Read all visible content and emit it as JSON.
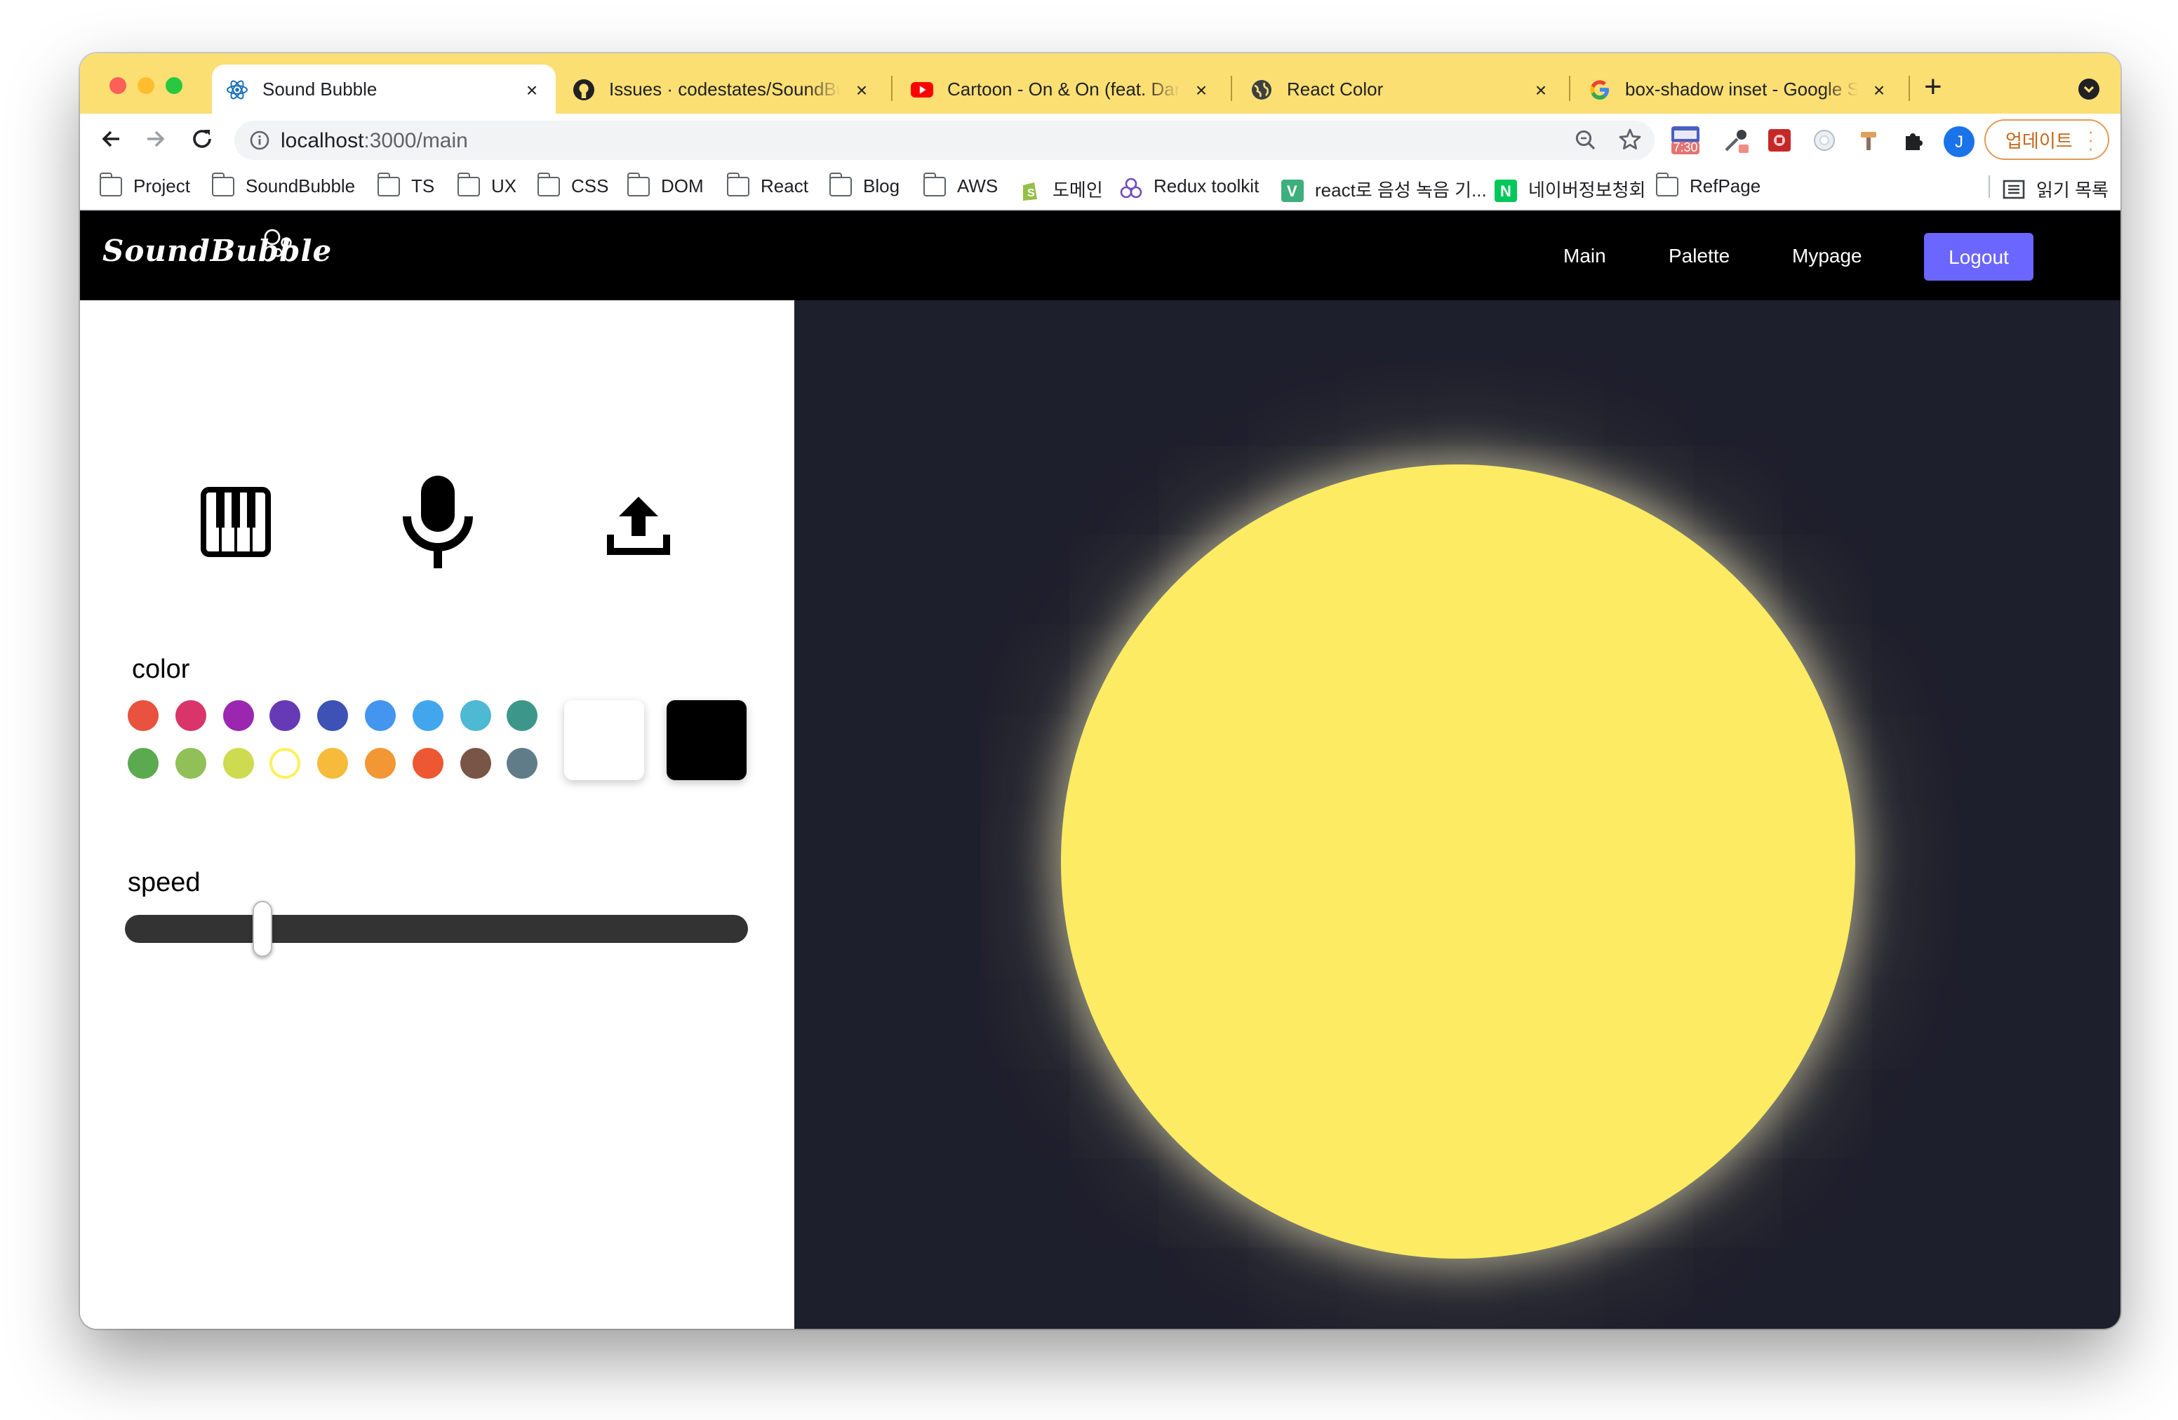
{
  "browser": {
    "tabs": [
      {
        "title": "Sound Bubble",
        "active": true,
        "favicon": "react-icon"
      },
      {
        "title": "Issues · codestates/SoundBubble",
        "active": false,
        "favicon": "github-icon"
      },
      {
        "title": "Cartoon - On & On (feat. Daniel Levi)",
        "active": false,
        "favicon": "youtube-icon"
      },
      {
        "title": "React Color",
        "active": false,
        "favicon": "globe-icon"
      },
      {
        "title": "box-shadow inset - Google Search",
        "active": false,
        "favicon": "google-icon"
      }
    ],
    "close_glyph": "×",
    "new_tab_glyph": "+",
    "url_host": "localhost",
    "url_path": ":3000/main",
    "extension_badge": "7:30",
    "avatar_letter": "J",
    "update_label": "업데이트",
    "bookmarks": [
      {
        "label": "Project",
        "icon": "folder-icon"
      },
      {
        "label": "SoundBubble",
        "icon": "folder-icon"
      },
      {
        "label": "TS",
        "icon": "folder-icon"
      },
      {
        "label": "UX",
        "icon": "folder-icon"
      },
      {
        "label": "CSS",
        "icon": "folder-icon"
      },
      {
        "label": "DOM",
        "icon": "folder-icon"
      },
      {
        "label": "React",
        "icon": "folder-icon"
      },
      {
        "label": "Blog",
        "icon": "folder-icon"
      },
      {
        "label": "AWS",
        "icon": "folder-icon"
      },
      {
        "label": "도메인",
        "icon": "shopify-icon"
      },
      {
        "label": "Redux toolkit",
        "icon": "redux-icon"
      },
      {
        "label": "react로 음성 녹음 기...",
        "icon": "vue-icon"
      },
      {
        "label": "네이버정보청회",
        "icon": "naver-icon"
      },
      {
        "label": "RefPage",
        "icon": "folder-icon"
      }
    ],
    "reading_list_label": "읽기 목록"
  },
  "app": {
    "logo": "SoundBubble",
    "nav": [
      "Main",
      "Palette",
      "Mypage"
    ],
    "logout_label": "Logout",
    "modes": [
      "piano-icon",
      "microphone-icon",
      "upload-icon"
    ],
    "color_label": "color",
    "swatches_row1": [
      "#e8523f",
      "#d9356a",
      "#9b27b0",
      "#663ab7",
      "#3e51b5",
      "#4395ef",
      "#42a6ee",
      "#4db9d3",
      "#3c978a"
    ],
    "swatches_row2": [
      "#5caa50",
      "#90c057",
      "#ccdb4f",
      "#fdf05a",
      "#f6bb3a",
      "#f29734",
      "#ed5832",
      "#795548",
      "#617c89"
    ],
    "selected_swatch": "#fdf05a",
    "big_swatches": [
      "#ffffff",
      "#000000"
    ],
    "speed_label": "speed",
    "speed_value": 0.22,
    "bubble_color": "#fceb63",
    "canvas_background": "#1e1f2c"
  }
}
